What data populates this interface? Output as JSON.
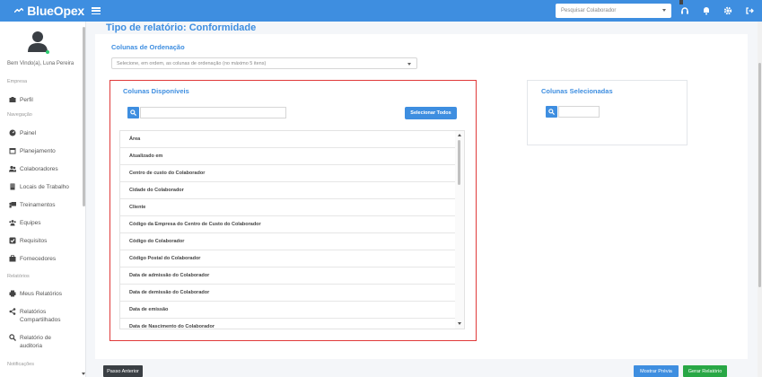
{
  "topbar": {
    "brand": "BlueOpex",
    "search_placeholder": "Pesquisar Colaborador",
    "icons": [
      "menu-icon",
      "headset-icon",
      "bell-icon",
      "gear-icon",
      "logout-icon"
    ]
  },
  "sidebar": {
    "welcome": "Bem Vindo(a), Luna Pereira",
    "sections": {
      "empresa": "Empresa",
      "navegacao": "Navegação",
      "relatorios": "Relatórios",
      "notificacoes": "Notificações"
    },
    "items": {
      "perfil": "Perfil",
      "painel": "Painel",
      "planejamento": "Planejamento",
      "colaboradores": "Colaboradores",
      "locais": "Locais de Trabalho",
      "treinamentos": "Treinamentos",
      "equipes": "Equipes",
      "requisitos": "Requisitos",
      "fornecedores": "Fornecedores",
      "meus_relatorios": "Meus Relatórios",
      "relatorios_compartilhados": "Relatórios Compartilhados",
      "relatorio_auditoria": "Relatório de auditoria"
    }
  },
  "main": {
    "title": "Tipo de relatório: Conformidade",
    "sort_label": "Colunas de Ordenação",
    "sort_placeholder": "Selecione, em ordem, as colunas de ordenação (no máximo 5 itens)",
    "available_title": "Colunas Disponíveis",
    "select_all": "Selecionar Todos",
    "selected_title": "Colunas Selecionadas",
    "columns": [
      "Área",
      "Atualizado em",
      "Centro de custo do Colaborador",
      "Cidade do Colaborador",
      "Cliente",
      "Código da Empresa do Centro de Custo do Colaborador",
      "Código do Colaborador",
      "Código Postal do Colaborador",
      "Data de admissão do Colaborador",
      "Data de demissão do Colaborador",
      "Data de emissão",
      "Data de Nascimento do Colaborador"
    ]
  },
  "footer": {
    "prev": "Passo Anterior",
    "preview": "Mostrar Prévia",
    "generate": "Gerar Relatório"
  },
  "colors": {
    "brand_blue": "#3e8ee0",
    "highlight_red": "#e03a3a",
    "success_green": "#28a745"
  }
}
